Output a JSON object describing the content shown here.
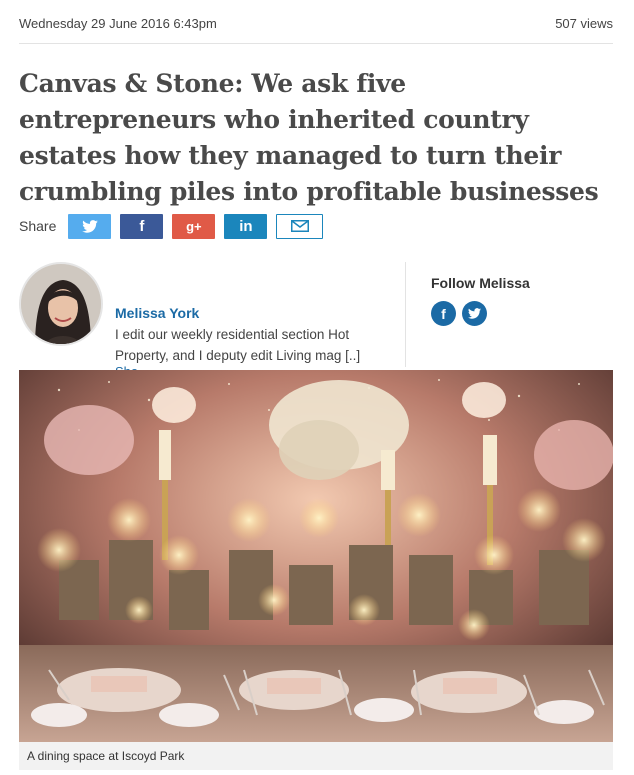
{
  "article": {
    "date": "Wednesday 29 June 2016 6:43pm",
    "views": "507 views",
    "headline": "Canvas & Stone: We ask five entrepreneurs who inherited country estates how they managed to turn their crumbling piles into profitable businesses"
  },
  "share": {
    "label": "Share",
    "buttons": [
      {
        "name": "twitter",
        "icon": "twitter-bird-icon",
        "color": "#55acee"
      },
      {
        "name": "facebook",
        "icon": "facebook-icon",
        "label": "f",
        "color": "#3b5998"
      },
      {
        "name": "google-plus",
        "icon": "google-plus-icon",
        "label": "g+",
        "color": "#e05a47"
      },
      {
        "name": "linkedin",
        "icon": "linkedin-icon",
        "label": "in",
        "color": "#1b86bc"
      },
      {
        "name": "email",
        "icon": "envelope-icon",
        "color": "#1b86bc"
      }
    ]
  },
  "author": {
    "name": "Melissa York",
    "bio": "I edit our weekly residential section Hot Property, and I deputy edit Living mag [..]",
    "show_more": "Sho"
  },
  "follow": {
    "title": "Follow Melissa",
    "facebook_label": "f"
  },
  "image": {
    "caption": "A dining space at Iscoyd Park"
  },
  "colors": {
    "link_blue": "#1b6aa5",
    "headline": "#4a4a4a"
  }
}
